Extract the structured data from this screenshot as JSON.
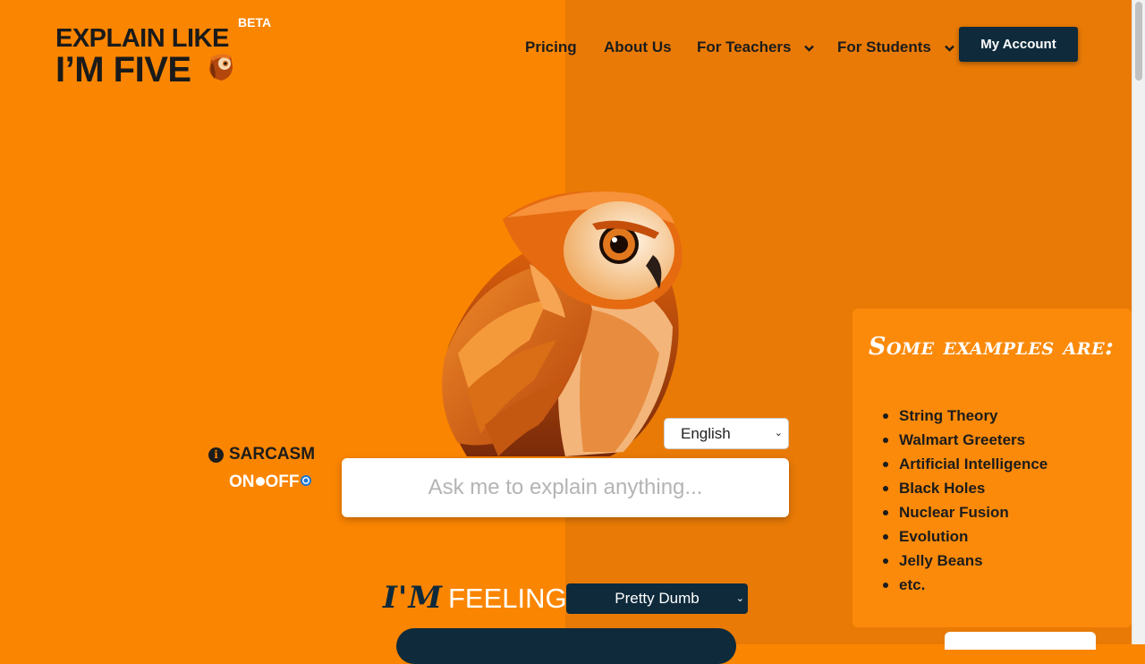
{
  "brand": {
    "line1": "EXPLAIN LIKE",
    "line2": "I’M FIVE",
    "badge": "BETA"
  },
  "nav": {
    "pricing": "Pricing",
    "about": "About Us",
    "teachers": "For Teachers",
    "students": "For Students",
    "account": "My Account"
  },
  "language": {
    "selected": "English"
  },
  "ask": {
    "placeholder": "Ask me to explain anything..."
  },
  "sarcasm": {
    "label": "SARCASM",
    "on_label": "ON",
    "off_label": "OFF",
    "selected": "OFF"
  },
  "feeling": {
    "prefix": "I'M",
    "word": "FEELING",
    "selected": "Pretty Dumb"
  },
  "examples": {
    "title": "Some examples are:",
    "items": [
      "String Theory",
      "Walmart Greeters",
      "Artificial Intelligence",
      "Black Holes",
      "Nuclear Fusion",
      "Evolution",
      "Jelly Beans",
      "etc."
    ]
  },
  "colors": {
    "background": "#fa8500",
    "background_right": "#e97a06",
    "navy": "#0e2a3b",
    "text": "#1c1c1c"
  },
  "icons": {
    "info": "info-circle-icon",
    "chevron": "chevron-down-icon",
    "mascot": "owl-mascot"
  }
}
